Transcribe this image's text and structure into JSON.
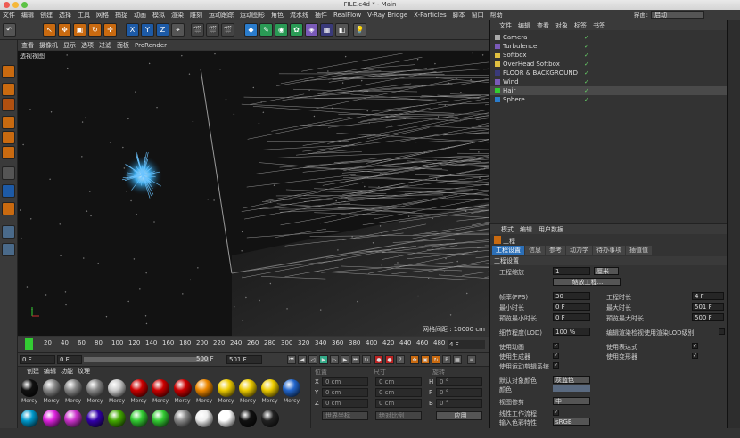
{
  "window": {
    "title": "FILE.c4d * - Main"
  },
  "menu": {
    "items": [
      "文件",
      "编辑",
      "创建",
      "选择",
      "工具",
      "网格",
      "捕捉",
      "动画",
      "模拟",
      "渲染",
      "雕刻",
      "运动跟踪",
      "运动图形",
      "角色",
      "流水线",
      "插件",
      "RealFlow",
      "V-Ray Bridge",
      "X-Particles",
      "脚本",
      "窗口",
      "帮助"
    ],
    "layout_label": "界面:",
    "layout_value": "启动"
  },
  "toolbar": {
    "axis": [
      "X",
      "Y",
      "Z"
    ]
  },
  "viewport": {
    "menu": [
      "查看",
      "摄像机",
      "显示",
      "选项",
      "过滤",
      "面板",
      "ProRender"
    ],
    "label": "透视视图",
    "grid_info": "网格间距 : 10000 cm"
  },
  "timeline": {
    "ticks": [
      "0",
      "20",
      "40",
      "60",
      "80",
      "100",
      "120",
      "140",
      "160",
      "180",
      "200",
      "220",
      "240",
      "260",
      "280",
      "300",
      "320",
      "340",
      "360",
      "380",
      "400",
      "420",
      "440",
      "460",
      "480",
      "500"
    ],
    "frame_badge": "4 F"
  },
  "playback": {
    "current": "0 F",
    "start": "0 F",
    "end": "500 F",
    "end2": "501 F"
  },
  "materials": {
    "menu": [
      "创建",
      "编辑",
      "功能",
      "纹理"
    ],
    "name": "Mercy",
    "row1": [
      "#111",
      "#888",
      "#888",
      "#888",
      "#ccc",
      "#c00",
      "#c00",
      "#c00",
      "#e80",
      "#ec0",
      "#ec0",
      "#ec0",
      "#26c"
    ],
    "row2": [
      "#09c",
      "#d2d",
      "#c3c",
      "#30a",
      "#4a0",
      "#3c3",
      "#3c3",
      "#888",
      "#eee",
      "#fff",
      "#111",
      "#222"
    ]
  },
  "coords": {
    "header1": "位置",
    "header2": "尺寸",
    "header3": "旋转",
    "x": "X",
    "y": "Y",
    "z": "Z",
    "h": "H",
    "p": "P",
    "b": "B",
    "zero_cm": "0 cm",
    "zero_deg": "0 °",
    "obj_coord": "世界坐标",
    "scale": "绝对比例",
    "apply": "应用"
  },
  "objects": {
    "menu": [
      "文件",
      "编辑",
      "查看",
      "对象",
      "标签",
      "书签"
    ],
    "items": [
      "Camera",
      "Turbulence",
      "Softbox",
      "OverHead Softbox",
      "FLOOR & BACKGROUND",
      "Wind",
      "Hair",
      "Sphere"
    ]
  },
  "attributes": {
    "menu": [
      "模式",
      "编辑",
      "用户数据"
    ],
    "title": "工程",
    "tabs": [
      "工程设置",
      "信息",
      "参考",
      "动力学",
      "待办事项",
      "插值值"
    ],
    "section": "工程设置",
    "scale_label": "工程缩放",
    "scale_value": "1",
    "scale_unit": "厘米",
    "scale_btn": "缩放工程...",
    "fps_label": "帧率(FPS)",
    "fps": "30",
    "min_time_label": "最小时长",
    "min_time": "0 F",
    "preview_min_label": "预览最小时长",
    "preview_min": "0 F",
    "lod_label": "细节程度(LOD)",
    "lod": "100 %",
    "proj_time_label": "工程时长",
    "proj_time": "4 F",
    "max_time_label": "最大时长",
    "max_time": "501 F",
    "preview_max_label": "预览最大时长",
    "preview_max": "500 F",
    "render_lod": "编辑渲染检视使用渲染LOD级别",
    "use_anim": "使用动画",
    "use_gen": "使用生成器",
    "use_motion": "使用运动剪辑系统",
    "use_expr": "使用表达式",
    "use_deform": "使用变形器",
    "default_color_label": "默认对象颜色",
    "default_color": "灰蓝色",
    "color_label": "颜色",
    "view_clip_label": "视图修剪",
    "view_clip": "中",
    "linear_label": "线性工作流程",
    "input_label": "输入色彩特性",
    "input_value": "sRGB"
  }
}
